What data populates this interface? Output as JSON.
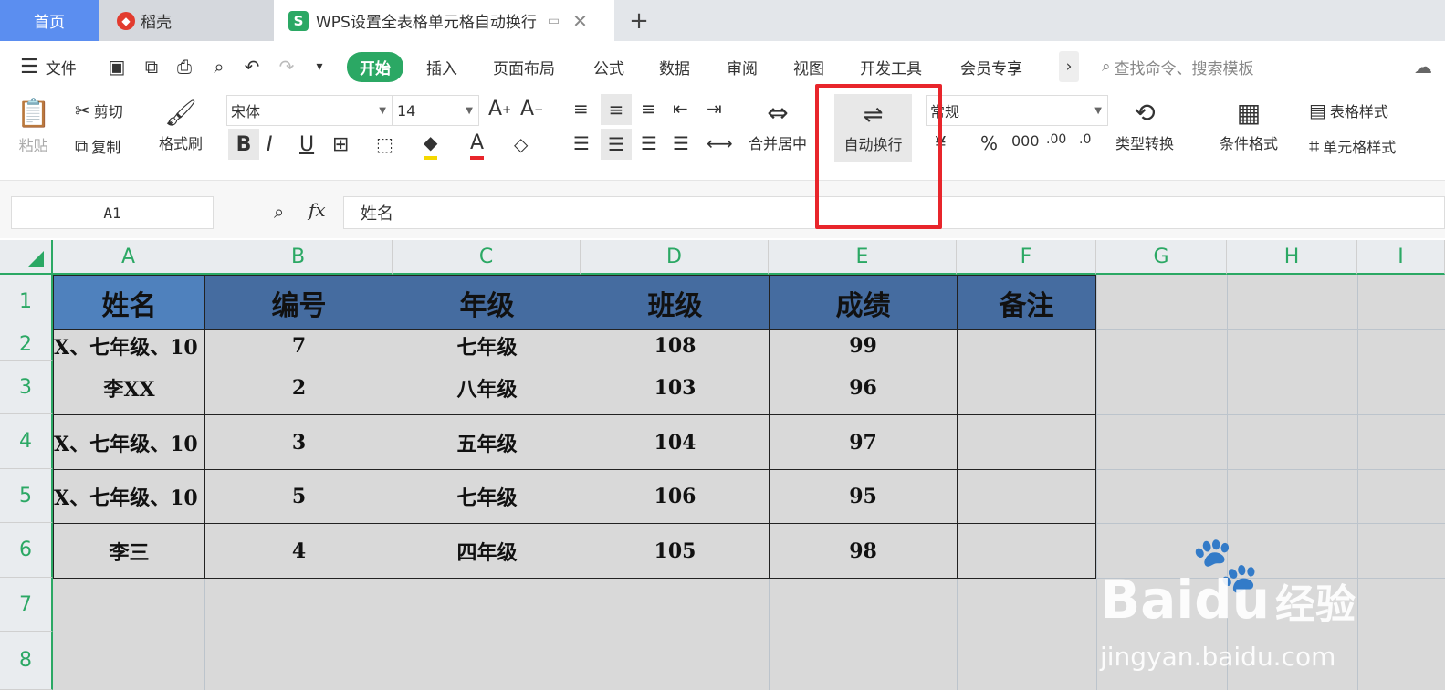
{
  "tabs": {
    "home": "首页",
    "daoke": "稻壳",
    "doc_title": "WPS设置全表格单元格自动换行",
    "add": "+"
  },
  "menu": {
    "file": "文件",
    "items": [
      "开始",
      "插入",
      "页面布局",
      "公式",
      "数据",
      "审阅",
      "视图",
      "开发工具",
      "会员专享"
    ],
    "more": "›",
    "search_placeholder": "查找命令、搜索模板"
  },
  "ribbon": {
    "paste": "粘贴",
    "cut": "剪切",
    "copy": "复制",
    "format_painter": "格式刷",
    "font_name": "宋体",
    "font_size": "14",
    "merge_center": "合并居中",
    "wrap_text": "自动换行",
    "number_format": "常规",
    "type_convert": "类型转换",
    "conditional_format": "条件格式",
    "table_style": "表格样式",
    "cell_style": "单元格样式"
  },
  "formula_bar": {
    "cell_ref": "A1",
    "fx": "fx",
    "content": "姓名"
  },
  "columns": [
    "A",
    "B",
    "C",
    "D",
    "E",
    "F",
    "G",
    "H",
    "I"
  ],
  "rows": [
    "1",
    "2",
    "3",
    "4",
    "5",
    "6",
    "7",
    "8"
  ],
  "table": {
    "headers": [
      "姓名",
      "编号",
      "年级",
      "班级",
      "成绩",
      "备注"
    ],
    "rows": [
      [
        "X、七年级、10",
        "7",
        "七年级",
        "108",
        "99",
        ""
      ],
      [
        "李XX",
        "2",
        "八年级",
        "103",
        "96",
        ""
      ],
      [
        "X、七年级、10",
        "3",
        "五年级",
        "104",
        "97",
        ""
      ],
      [
        "X、七年级、10",
        "5",
        "七年级",
        "106",
        "95",
        ""
      ],
      [
        "李三",
        "4",
        "四年级",
        "105",
        "98",
        ""
      ]
    ]
  },
  "watermark": {
    "brand": "Bai",
    "brand2": "du",
    "suffix": "经验",
    "url": "jingyan.baidu.com"
  },
  "colors": {
    "accent": "#2ba864",
    "header_fill": "#456ca0",
    "highlight": "#e8252b"
  }
}
